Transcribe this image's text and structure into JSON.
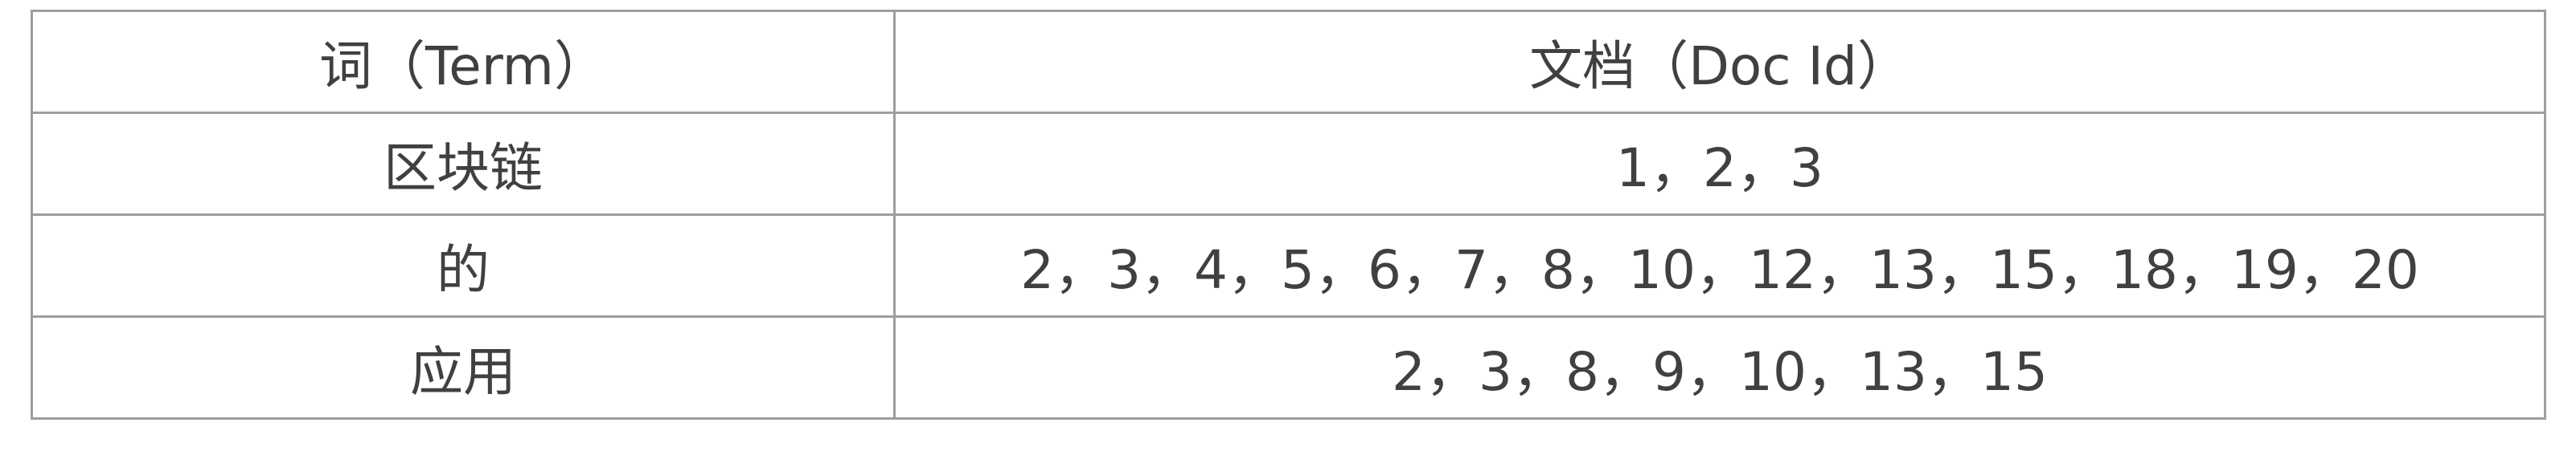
{
  "table": {
    "headers": [
      "词（Term）",
      "文档（Doc Id）"
    ],
    "rows": [
      {
        "term": "区块链",
        "docs": "1，2，3"
      },
      {
        "term": "的",
        "docs": "2，3，4，5，6，7，8，10，12，13，15，18，19，20"
      },
      {
        "term": "应用",
        "docs": "2，3，8，9，10，13，15"
      }
    ]
  }
}
